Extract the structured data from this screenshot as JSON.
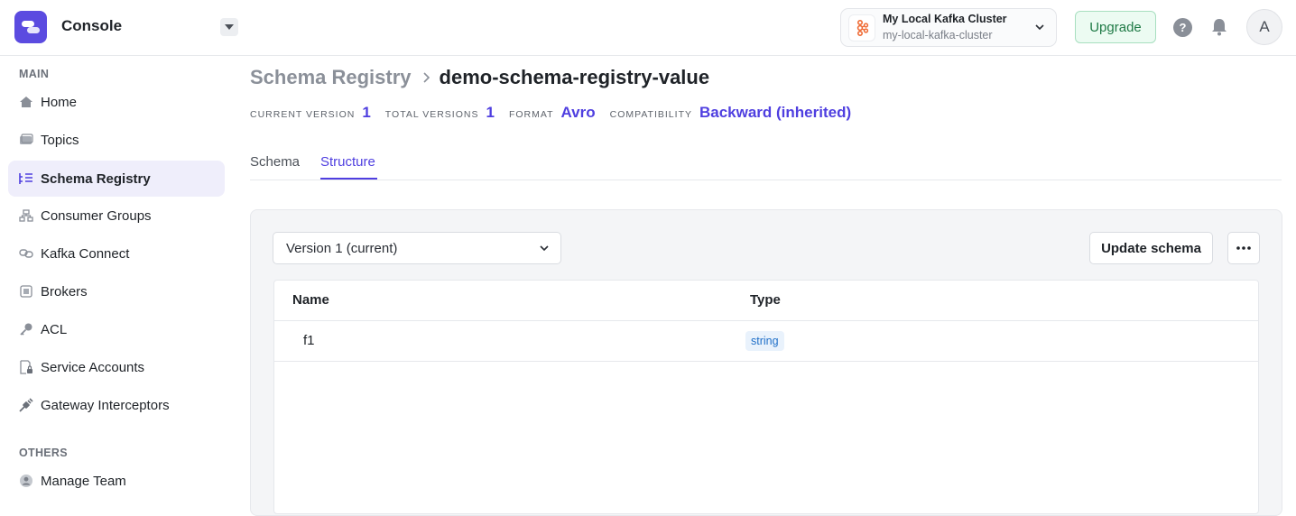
{
  "app": {
    "title": "Console"
  },
  "cluster": {
    "name": "My Local Kafka Cluster",
    "id": "my-local-kafka-cluster"
  },
  "header": {
    "upgrade_label": "Upgrade",
    "help_glyph": "?",
    "avatar_initial": "A"
  },
  "sidebar": {
    "sections": [
      {
        "label": "MAIN",
        "items": [
          {
            "label": "Home",
            "icon": "home-icon"
          },
          {
            "label": "Topics",
            "icon": "topics-icon"
          },
          {
            "label": "Schema Registry",
            "icon": "schema-registry-icon",
            "active": true
          },
          {
            "label": "Consumer Groups",
            "icon": "consumer-groups-icon"
          },
          {
            "label": "Kafka Connect",
            "icon": "kafka-connect-icon"
          },
          {
            "label": "Brokers",
            "icon": "brokers-icon"
          },
          {
            "label": "ACL",
            "icon": "key-icon"
          },
          {
            "label": "Service Accounts",
            "icon": "service-accounts-icon"
          },
          {
            "label": "Gateway Interceptors",
            "icon": "gateway-interceptors-icon"
          }
        ]
      },
      {
        "label": "OTHERS",
        "items": [
          {
            "label": "Manage Team",
            "icon": "manage-team-icon"
          }
        ]
      }
    ]
  },
  "breadcrumb": {
    "root": "Schema Registry",
    "current": "demo-schema-registry-value"
  },
  "meta": {
    "current_version_label": "CURRENT VERSION",
    "current_version": "1",
    "total_versions_label": "TOTAL VERSIONS",
    "total_versions": "1",
    "format_label": "FORMAT",
    "format": "Avro",
    "compatibility_label": "COMPATIBILITY",
    "compatibility": "Backward (inherited)"
  },
  "tabs": [
    {
      "label": "Schema"
    },
    {
      "label": "Structure",
      "active": true
    }
  ],
  "toolbar": {
    "version_select_value": "Version 1 (current)",
    "update_label": "Update schema"
  },
  "table": {
    "columns": [
      "Name",
      "Type"
    ],
    "rows": [
      {
        "name": "f1",
        "type": "string"
      }
    ]
  },
  "colors": {
    "accent": "#4f3fe0",
    "brand": "#5b4be0",
    "upgrade": "#1f7a46"
  }
}
